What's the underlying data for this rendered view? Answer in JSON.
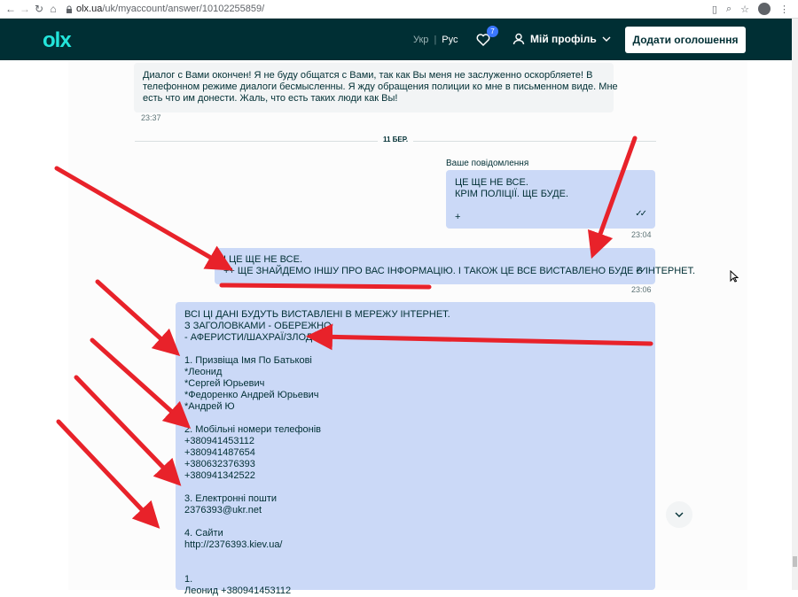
{
  "browser": {
    "url_host": "olx.ua",
    "url_path": "/uk/myaccount/answer/10102255859/"
  },
  "header": {
    "logo": "olx",
    "lang_uk": "Укр",
    "lang_ru": "Рус",
    "favorites_count": "7",
    "profile_label": "Мій профіль",
    "add_button": "Додати оголошення"
  },
  "chat": {
    "incoming": {
      "lines": [
        "Диалог с Вами окончен! Я не буду общатся с Вами, так как Вы меня не заслуженно оскорбляете! В",
        "телефонном режиме диалоги бесмысленны. Я жду обращения полиции ко мне в письменном виде. Мне",
        "есть что им донести. Жаль, что есть таких люди как Вы!"
      ],
      "time": "23:37"
    },
    "date_divider": "11 БЕР.",
    "own_label": "Ваше повідомлення",
    "msg1": {
      "lines": [
        "ЦЕ ЩЕ НЕ ВСЕ.",
        "КРІМ ПОЛІЦІЇ. ЩЕ БУДЕ.",
        "",
        "+"
      ],
      "time": "23:04"
    },
    "msg2": {
      "lines": [
        "І ЦЕ ЩЕ НЕ ВСЕ.",
        "++ ЩЕ ЗНАЙДЕМО ІНШУ ПРО ВАС ІНФОРМАЦІЮ. І ТАКОЖ ЦЕ ВСЕ ВИСТАВЛЕНО БУДЕ В ІНТЕРНЕТ."
      ],
      "time": "23:06"
    },
    "msg3": {
      "lines": [
        "ВСІ ЦІ ДАНІ БУДУТЬ ВИСТАВЛЕНІ В МЕРЕЖУ ІНТЕРНЕТ.",
        "З ЗАГОЛОВКАМИ - ОБЕРЕЖНО",
        "- АФЕРИСТИ/ШАХРАЇ/ЗЛОДІЇ.",
        "",
        "1. Призвіща Імя По Батькові",
        "*Леонид",
        "*Сергей Юрьевич",
        "*Федоренко Андрей Юрьевич",
        "*Андрей Ю",
        "",
        "2. Мобільні номери телефонів",
        "+380941453112",
        "+380941487654",
        "+380632376393",
        "+380941342522",
        "",
        "3. Електронні пошти",
        "2376393@ukr.net",
        "",
        "4. Сайти",
        "http://2376393.kiev.ua/",
        "",
        "",
        "1.",
        "Леонид +380941453112"
      ]
    }
  },
  "icons": {
    "back": "arrow-left-icon",
    "forward": "arrow-right-icon",
    "reload": "reload-icon",
    "home": "home-icon",
    "lock": "lock-icon",
    "heart": "heart-icon",
    "user": "user-icon",
    "chevron": "chevron-down-icon",
    "read": "double-check-icon"
  },
  "colors": {
    "header_bg": "#002f34",
    "logo": "#23e5db",
    "own_bubble": "#cbd9f7",
    "arrow": "#e8222a"
  }
}
